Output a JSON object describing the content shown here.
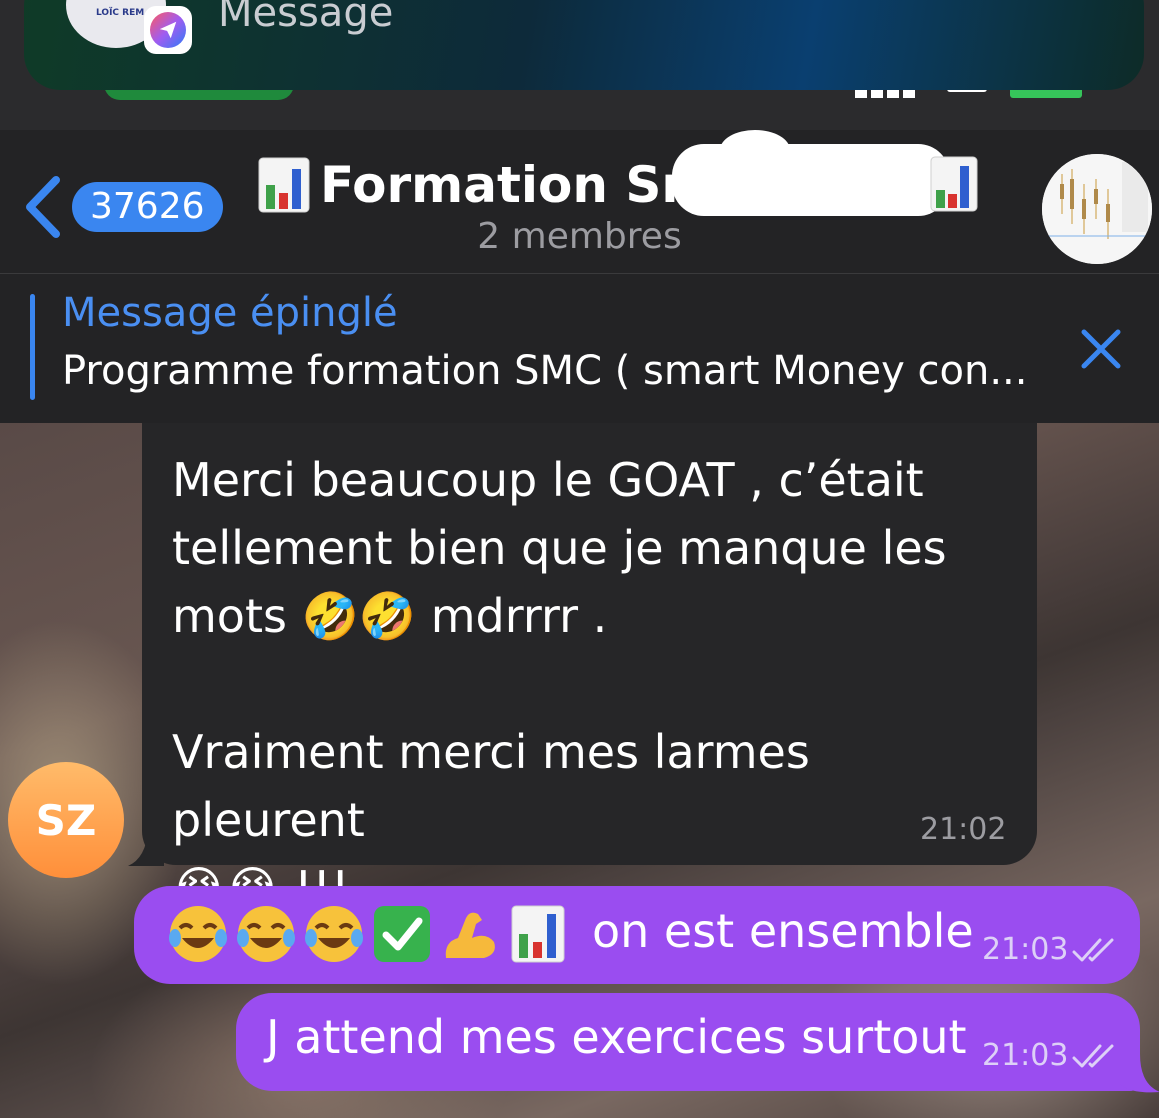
{
  "notification": {
    "text": "Message",
    "app_icon": "telegram-icon",
    "avatar_logo_text": "LOÏC REM"
  },
  "header": {
    "unread_count": "37626",
    "title": "Formation SmC",
    "title_emoji": "chart-emoji",
    "subtitle": "2 membres",
    "back_icon": "chevron-left-icon"
  },
  "pinned": {
    "label": "Message épinglé",
    "text": "Programme formation SMC ( smart Money con...",
    "close_icon": "close-icon"
  },
  "messages": [
    {
      "direction": "in",
      "sender_initials": "SZ",
      "text": "Merci beaucoup le GOAT , c’était\ntellement bien que je manque les\nmots 🤣🤣 mdrrrr .\n\nVraiment merci mes larmes pleurent\n😭😭 !!!",
      "time": "21:02"
    },
    {
      "direction": "out",
      "emojis": [
        "😂",
        "😂",
        "😂",
        "✅",
        "💪",
        "📊"
      ],
      "text": "on est ensemble",
      "time": "21:03",
      "status_icon": "double-check-icon"
    },
    {
      "direction": "out",
      "text": "J attend mes exercices surtout",
      "time": "21:03",
      "status_icon": "double-check-icon"
    }
  ],
  "colors": {
    "accent_blue": "#3a86f0",
    "outgoing_bubble": "#9a4df0",
    "incoming_bubble": "#262628",
    "avatar_orange": "#ff9f45"
  }
}
